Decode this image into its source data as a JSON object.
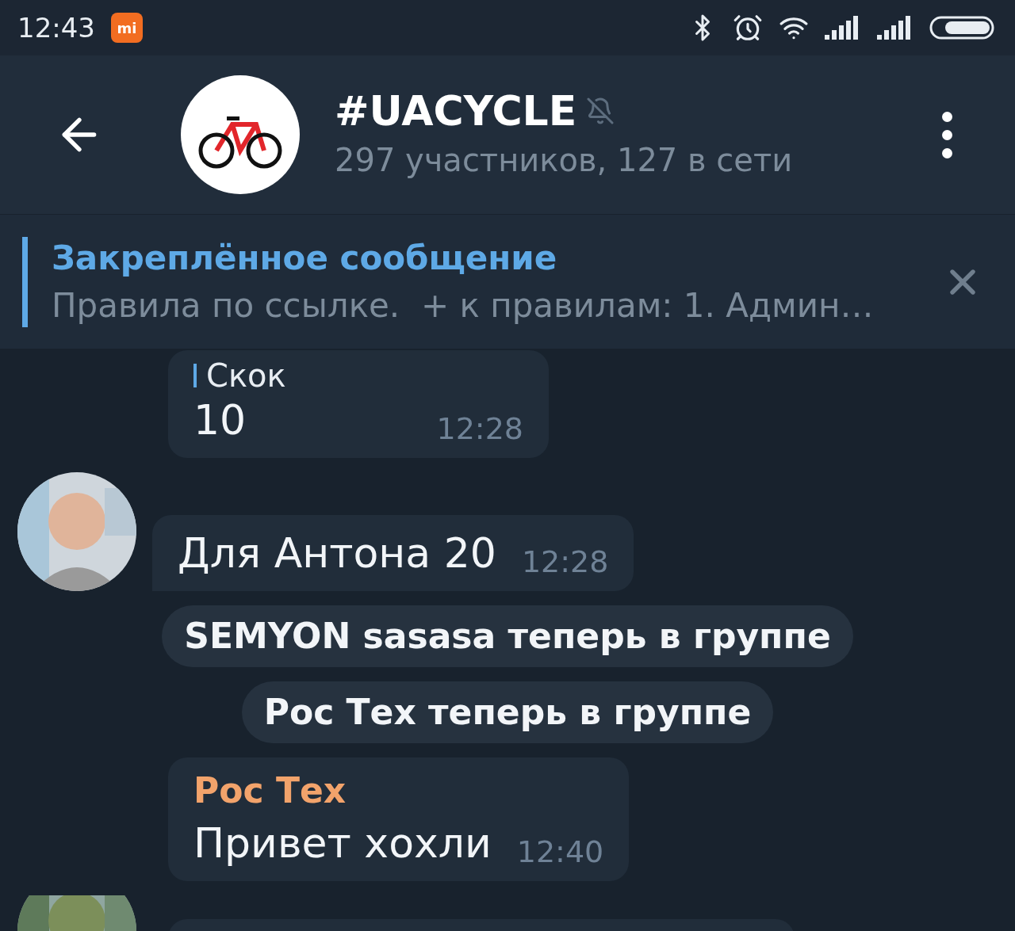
{
  "status_bar": {
    "time": "12:43",
    "badge": "mi"
  },
  "header": {
    "title": "#UACYCLE",
    "muted": true,
    "subtitle": "297 участников, 127 в сети"
  },
  "pinned": {
    "title": "Закреплённое сообщение",
    "text": "Правила по ссылке.  + к правилам: 1. Админ…"
  },
  "messages": [
    {
      "kind": "bubble",
      "avatar": false,
      "reply": "Скок",
      "text": "10",
      "time": "12:28"
    },
    {
      "kind": "bubble",
      "avatar": true,
      "text": "Для Антона 20",
      "time": "12:28"
    },
    {
      "kind": "service",
      "text": "SEMYON sasasa теперь в группе"
    },
    {
      "kind": "service",
      "text": "Рос Тех теперь в группе"
    },
    {
      "kind": "bubble",
      "avatar": false,
      "sender": "Рос Тех",
      "color": "#f2a36b",
      "text": "Привет хохли",
      "time": "12:40"
    },
    {
      "kind": "stub",
      "avatar": true
    }
  ]
}
